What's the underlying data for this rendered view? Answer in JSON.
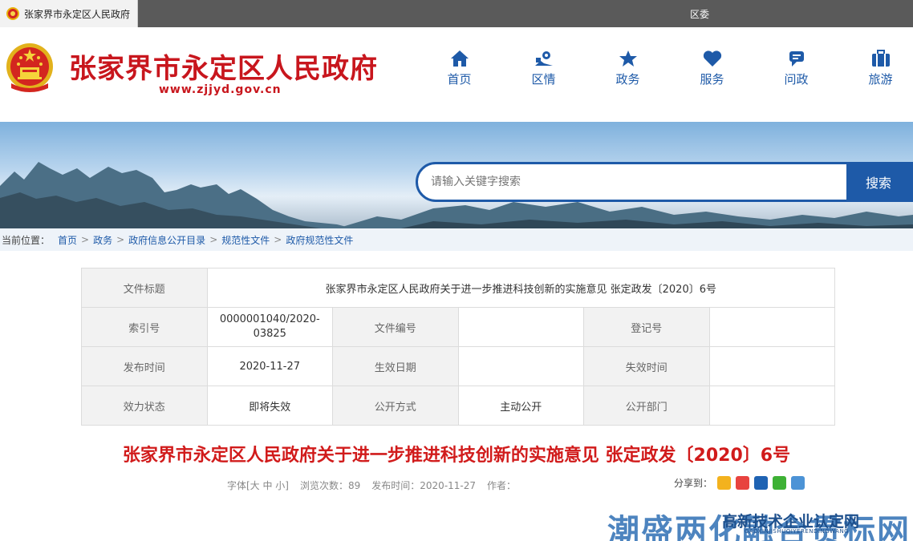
{
  "browser_tab": {
    "title": "张家界市永定区人民政府",
    "right_link": "区委"
  },
  "header": {
    "title": "张家界市永定区人民政府",
    "url": "www.zjjyd.gov.cn",
    "nav": [
      {
        "label": "首页",
        "icon": "home-icon"
      },
      {
        "label": "区情",
        "icon": "map-pin-icon"
      },
      {
        "label": "政务",
        "icon": "star-icon"
      },
      {
        "label": "服务",
        "icon": "heart-icon"
      },
      {
        "label": "问政",
        "icon": "chat-icon"
      },
      {
        "label": "旅游",
        "icon": "suitcase-icon"
      }
    ]
  },
  "search": {
    "placeholder": "请输入关键字搜索",
    "button": "搜索"
  },
  "breadcrumb": {
    "prefix": "当前位置：",
    "items": [
      "首页",
      "政务",
      "政府信息公开目录",
      "规范性文件",
      "政府规范性文件"
    ],
    "separator": ">"
  },
  "info_table": {
    "doc_title_label": "文件标题",
    "doc_title_value": "张家界市永定区人民政府关于进一步推进科技创新的实施意见 张定政发〔2020〕6号",
    "rows": [
      [
        "索引号",
        "0000001040/2020-03825",
        "文件编号",
        "",
        "登记号",
        ""
      ],
      [
        "发布时间",
        "2020-11-27",
        "生效日期",
        "",
        "失效时间",
        ""
      ],
      [
        "效力状态",
        "即将失效",
        "公开方式",
        "主动公开",
        "公开部门",
        ""
      ]
    ]
  },
  "article": {
    "title": "张家界市永定区人民政府关于进一步推进科技创新的实施意见 张定政发〔2020〕6号",
    "font_size": "字体[大 中 小]",
    "views": "浏览次数：89",
    "publish": "发布时间：2020-11-27",
    "author": "作者：",
    "share_label": "分享到："
  },
  "watermark": {
    "main": "潮盛两化融合贯标网",
    "sub": "高新技术企业认定网",
    "sub_en": "GAOXINJISHUQIYERENDINGWANG"
  },
  "colors": {
    "brand_red": "#c8161d",
    "brand_blue": "#1e5aa8",
    "title_red": "#d11b1b"
  }
}
